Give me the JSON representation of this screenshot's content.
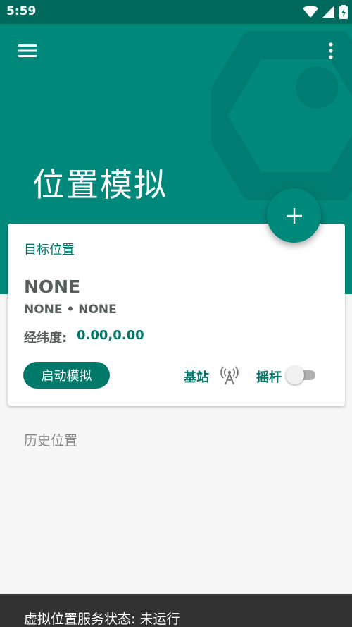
{
  "status_bar": {
    "time": "5:59",
    "icons": [
      "wifi-icon",
      "signal-icon",
      "battery-icon"
    ]
  },
  "app_bar": {
    "title": "位置模拟",
    "color": "#00897b",
    "menu_icon": "hamburger-menu-icon",
    "more_icon": "more-vertical-icon"
  },
  "fab": {
    "icon": "plus-icon"
  },
  "target_card": {
    "title": "目标位置",
    "location_name": "NONE",
    "location_sub": "NONE • NONE",
    "coord_label": "经纬度:",
    "coord_value": "0.00,0.00",
    "start_button": "启动模拟",
    "station_label": "基站",
    "station_icon": "antenna-icon",
    "joystick_label": "摇杆",
    "joystick_enabled": false
  },
  "history": {
    "label": "历史位置"
  },
  "footer": {
    "status_text": "虚拟位置服务状态: 未运行"
  }
}
